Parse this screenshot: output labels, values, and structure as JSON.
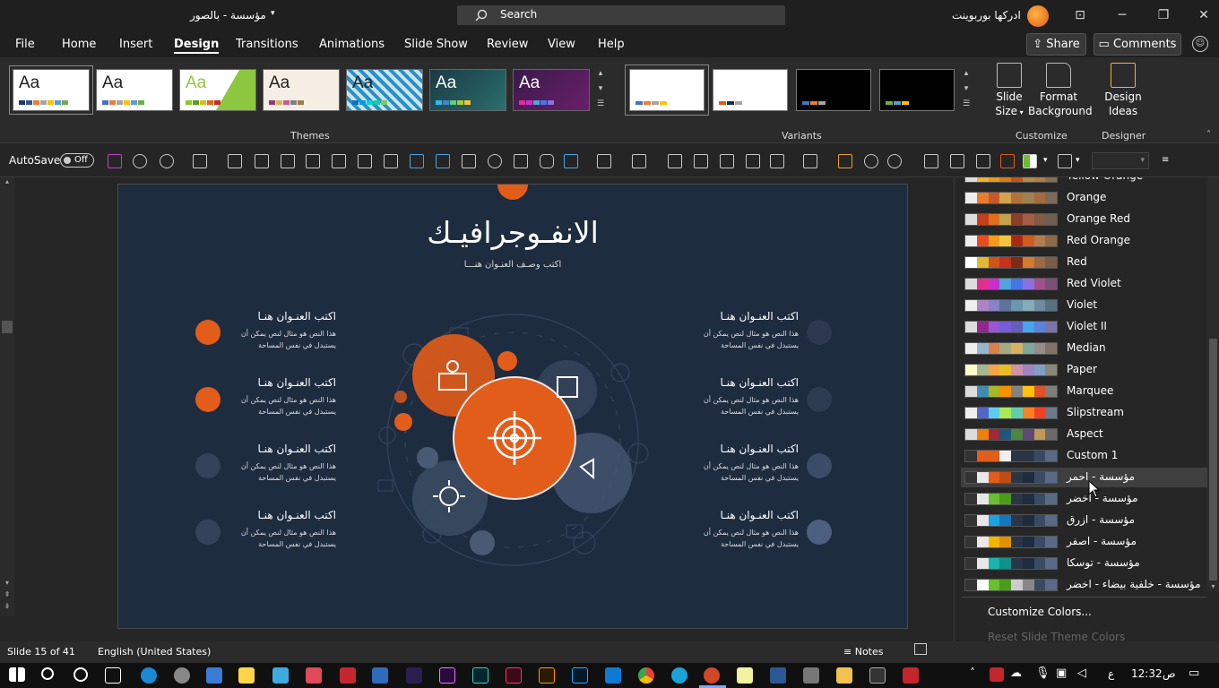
{
  "titlebar": {
    "doc_title": "مؤسسة - بالصور",
    "search": "Search",
    "account": "ادركها بوربوينت"
  },
  "menu": [
    "File",
    "Home",
    "Insert",
    "Design",
    "Transitions",
    "Animations",
    "Slide Show",
    "Review",
    "View",
    "Help"
  ],
  "share": "Share",
  "comments": "Comments",
  "ribbon": {
    "themes_label": "Themes",
    "variants_label": "Variants",
    "customize_label": "Customize",
    "designer_label": "Designer",
    "slide_size": [
      "Slide",
      "Size"
    ],
    "format_background": [
      "Format",
      "Background"
    ],
    "design_ideas": [
      "Design",
      "Ideas"
    ],
    "theme_text": "Aa"
  },
  "qat": {
    "autosave": "AutoSave",
    "toggle": "Off"
  },
  "slide": {
    "title": "الانفـوجرافيـك",
    "subtitle": "اكتب وصـف العنـوان هنـــا",
    "item_title": "اكتب العنـوان هنـا",
    "item_body": "هذا النص هو مثال لنص يمكن أن يستبدل في نفس المساحة"
  },
  "colors": [
    {
      "name": "Yellow Orange",
      "swatch": [
        "#dddddd",
        "#f2b134",
        "#e69b20",
        "#d97c15",
        "#c2541a",
        "#ab8e4e",
        "#b07d4a",
        "#86704f"
      ]
    },
    {
      "name": "Orange",
      "swatch": [
        "#eeeeee",
        "#e87d2c",
        "#c5592b",
        "#d4a24c",
        "#b17339",
        "#9d8152",
        "#a66a3c",
        "#7a6a58"
      ]
    },
    {
      "name": "Orange Red",
      "swatch": [
        "#dddddd",
        "#c63e1c",
        "#e26e1d",
        "#c2a14f",
        "#8b3e2a",
        "#a45c45",
        "#7f5b45",
        "#6e5e54"
      ]
    },
    {
      "name": "Red Orange",
      "swatch": [
        "#eeeeee",
        "#e84c22",
        "#f39c1e",
        "#f0c53d",
        "#a62a14",
        "#d05b21",
        "#b07c52",
        "#8d6a4a"
      ]
    },
    {
      "name": "Red",
      "swatch": [
        "#ffffff",
        "#e0ba2e",
        "#d05419",
        "#c6321d",
        "#7e2b17",
        "#d6792b",
        "#9a6a45",
        "#7c5c4b"
      ]
    },
    {
      "name": "Red Violet",
      "swatch": [
        "#dddddd",
        "#e32d91",
        "#c830cc",
        "#4ea6dc",
        "#4775e7",
        "#8971e1",
        "#a24f8f",
        "#7a5079"
      ]
    },
    {
      "name": "Violet",
      "swatch": [
        "#eeeeee",
        "#ad84c6",
        "#8784c7",
        "#5d739a",
        "#6997af",
        "#84acb6",
        "#6f8ba0",
        "#567182"
      ]
    },
    {
      "name": "Violet II",
      "swatch": [
        "#dddddd",
        "#92278f",
        "#9b57d3",
        "#755dd9",
        "#665eb8",
        "#45a5ed",
        "#5982db",
        "#7a74a8"
      ]
    },
    {
      "name": "Median",
      "swatch": [
        "#eeeeee",
        "#94b6d2",
        "#dd8047",
        "#a5ab81",
        "#d8b25c",
        "#7ba79d",
        "#968c8c",
        "#827365"
      ]
    },
    {
      "name": "Paper",
      "swatch": [
        "#fefac9",
        "#a5b592",
        "#f3a447",
        "#e7bc29",
        "#d092a7",
        "#9c85c0",
        "#809ec2",
        "#8a8779"
      ]
    },
    {
      "name": "Marquee",
      "swatch": [
        "#dddddd",
        "#418ab3",
        "#a6b727",
        "#f69200",
        "#838383",
        "#fec306",
        "#df5327",
        "#7f7f7f"
      ]
    },
    {
      "name": "Slipstream",
      "swatch": [
        "#eeeeee",
        "#4e67c8",
        "#5eccf3",
        "#a7ea52",
        "#5dceaf",
        "#ff8021",
        "#f14124",
        "#6b7a8c"
      ]
    },
    {
      "name": "Aspect",
      "swatch": [
        "#dddddd",
        "#f07f09",
        "#9f2936",
        "#1b587c",
        "#4e8542",
        "#604878",
        "#c19859",
        "#6a6a6a"
      ]
    },
    {
      "name": "Custom 1",
      "swatch": [
        "#333333",
        "#e25c1a",
        "#e25c1a",
        "#f0f0f0",
        "#2a3648",
        "#2a3648",
        "#3a4a62",
        "#5a6a86"
      ]
    },
    {
      "name": "مؤسسة - احمر",
      "swatch": [
        "#333333",
        "#e8e8e8",
        "#e25c1a",
        "#c14c12",
        "#2a3648",
        "#1e2c40",
        "#3a4a62",
        "#5a6a86"
      ]
    },
    {
      "name": "مؤسسة - اخضر",
      "swatch": [
        "#333333",
        "#e8e8e8",
        "#6abf2f",
        "#4c9c1b",
        "#2a3648",
        "#1e2c40",
        "#3a4a62",
        "#5a6a86"
      ]
    },
    {
      "name": "مؤسسة - ازرق",
      "swatch": [
        "#333333",
        "#e8e8e8",
        "#1fa3e0",
        "#1478c1",
        "#2a3648",
        "#1e2c40",
        "#3a4a62",
        "#5a6a86"
      ]
    },
    {
      "name": "مؤسسة - اصفر",
      "swatch": [
        "#333333",
        "#e8e8e8",
        "#f5b400",
        "#e09200",
        "#2a3648",
        "#1e2c40",
        "#3a4a62",
        "#5a6a86"
      ]
    },
    {
      "name": "مؤسسة - توسكا",
      "swatch": [
        "#333333",
        "#e8e8e8",
        "#1ab3ad",
        "#12908b",
        "#2a3648",
        "#1e2c40",
        "#3a4a62",
        "#5a6a86"
      ]
    },
    {
      "name": "مؤسسة - خلفية بيضاء - اخضر",
      "swatch": [
        "#333333",
        "#ffffff",
        "#6abf2f",
        "#4c9c1b",
        "#cccccc",
        "#888888",
        "#3a4a62",
        "#5a6a86"
      ]
    }
  ],
  "customize_colors": "Customize Colors...",
  "reset_colors": "Reset Slide Theme Colors",
  "status": {
    "slide": "Slide 15 of 41",
    "language": "English (United States)",
    "notes": "Notes"
  },
  "taskbar": {
    "time": "12:32",
    "ampm": "ص",
    "lang": "ع"
  }
}
